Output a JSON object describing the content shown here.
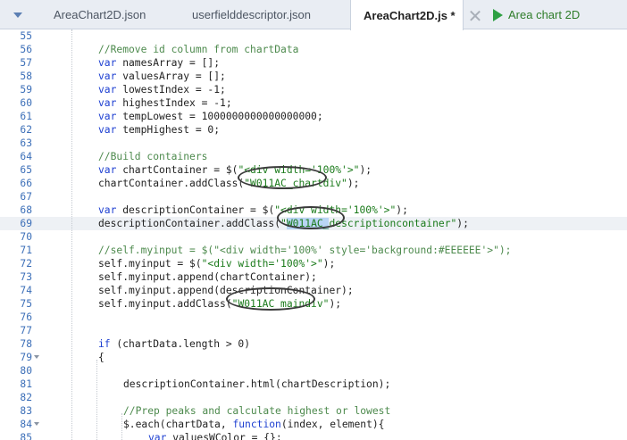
{
  "tabs": {
    "items": [
      {
        "label": "AreaChart2D.json"
      },
      {
        "label": "userfielddescriptor.json"
      },
      {
        "label": "AreaChart2D.js *"
      }
    ],
    "preview_label": "Area chart 2D"
  },
  "editor": {
    "lines": [
      {
        "n": "55",
        "fold": false,
        "t": []
      },
      {
        "n": "56",
        "fold": false,
        "t": [
          {
            "c": "cm",
            "v": "//Remove id column from chartData"
          }
        ]
      },
      {
        "n": "57",
        "fold": false,
        "t": [
          {
            "c": "kw",
            "v": "var"
          },
          {
            "c": "",
            "v": " namesArray = [];"
          }
        ]
      },
      {
        "n": "58",
        "fold": false,
        "t": [
          {
            "c": "kw",
            "v": "var"
          },
          {
            "c": "",
            "v": " valuesArray = [];"
          }
        ]
      },
      {
        "n": "59",
        "fold": false,
        "t": [
          {
            "c": "kw",
            "v": "var"
          },
          {
            "c": "",
            "v": " lowestIndex = -1;"
          }
        ]
      },
      {
        "n": "60",
        "fold": false,
        "t": [
          {
            "c": "kw",
            "v": "var"
          },
          {
            "c": "",
            "v": " highestIndex = -1;"
          }
        ]
      },
      {
        "n": "61",
        "fold": false,
        "t": [
          {
            "c": "kw",
            "v": "var"
          },
          {
            "c": "",
            "v": " tempLowest = 1000000000000000000;"
          }
        ]
      },
      {
        "n": "62",
        "fold": false,
        "t": [
          {
            "c": "kw",
            "v": "var"
          },
          {
            "c": "",
            "v": " tempHighest = 0;"
          }
        ]
      },
      {
        "n": "63",
        "fold": false,
        "t": []
      },
      {
        "n": "64",
        "fold": false,
        "t": [
          {
            "c": "cm",
            "v": "//Build containers"
          }
        ]
      },
      {
        "n": "65",
        "fold": false,
        "t": [
          {
            "c": "kw",
            "v": "var"
          },
          {
            "c": "",
            "v": " chartContainer = $("
          },
          {
            "c": "st",
            "v": "\"<div width='100%'>\""
          },
          {
            "c": "",
            "v": ");"
          }
        ]
      },
      {
        "n": "66",
        "fold": false,
        "t": [
          {
            "c": "",
            "v": "chartContainer.addClass("
          },
          {
            "c": "st",
            "v": "\"W011AC_chartdiv\""
          },
          {
            "c": "",
            "v": ");"
          }
        ]
      },
      {
        "n": "67",
        "fold": false,
        "t": []
      },
      {
        "n": "68",
        "fold": false,
        "t": [
          {
            "c": "kw",
            "v": "var"
          },
          {
            "c": "",
            "v": " descriptionContainer = $("
          },
          {
            "c": "st",
            "v": "\"<div width='100%'>\""
          },
          {
            "c": "",
            "v": ");"
          }
        ]
      },
      {
        "n": "69",
        "fold": false,
        "hl": true,
        "t": [
          {
            "c": "",
            "v": "descriptionContainer.addClass("
          },
          {
            "c": "st",
            "v": "\""
          },
          {
            "c": "st sel",
            "v": "W011AC_"
          },
          {
            "c": "st",
            "v": "descriptioncontainer\""
          },
          {
            "c": "",
            "v": ");"
          }
        ]
      },
      {
        "n": "70",
        "fold": false,
        "t": []
      },
      {
        "n": "71",
        "fold": false,
        "t": [
          {
            "c": "cm",
            "v": "//self.myinput = $(\"<div width='100%' style='background:#EEEEEE'>\");"
          }
        ]
      },
      {
        "n": "72",
        "fold": false,
        "t": [
          {
            "c": "",
            "v": "self.myinput = $("
          },
          {
            "c": "st",
            "v": "\"<div width='100%'>\""
          },
          {
            "c": "",
            "v": ");"
          }
        ]
      },
      {
        "n": "73",
        "fold": false,
        "t": [
          {
            "c": "",
            "v": "self.myinput.append(chartContainer);"
          }
        ]
      },
      {
        "n": "74",
        "fold": false,
        "t": [
          {
            "c": "",
            "v": "self.myinput.append(descriptionContainer);"
          }
        ]
      },
      {
        "n": "75",
        "fold": false,
        "t": [
          {
            "c": "",
            "v": "self.myinput.addClass("
          },
          {
            "c": "st",
            "v": "\"W011AC_maindiv\""
          },
          {
            "c": "",
            "v": ");"
          }
        ]
      },
      {
        "n": "76",
        "fold": false,
        "t": []
      },
      {
        "n": "77",
        "fold": false,
        "t": []
      },
      {
        "n": "78",
        "fold": false,
        "t": [
          {
            "c": "kw",
            "v": "if"
          },
          {
            "c": "",
            "v": " (chartData.length > 0)"
          }
        ]
      },
      {
        "n": "79",
        "fold": true,
        "t": [
          {
            "c": "",
            "v": "{"
          }
        ]
      },
      {
        "n": "80",
        "fold": false,
        "t": []
      },
      {
        "n": "81",
        "fold": false,
        "indent": 1,
        "t": [
          {
            "c": "",
            "v": "descriptionContainer.html(chartDescription);"
          }
        ]
      },
      {
        "n": "82",
        "fold": false,
        "t": []
      },
      {
        "n": "83",
        "fold": false,
        "indent": 1,
        "t": [
          {
            "c": "cm",
            "v": "//Prep peaks and calculate highest or lowest"
          }
        ]
      },
      {
        "n": "84",
        "fold": true,
        "indent": 1,
        "t": [
          {
            "c": "",
            "v": "$.each(chartData, "
          },
          {
            "c": "kw",
            "v": "function"
          },
          {
            "c": "",
            "v": "(index, element){"
          }
        ]
      },
      {
        "n": "85",
        "fold": false,
        "indent": 2,
        "t": [
          {
            "c": "kw",
            "v": "var"
          },
          {
            "c": "",
            "v": " valuesWColor = {};"
          }
        ]
      }
    ]
  }
}
